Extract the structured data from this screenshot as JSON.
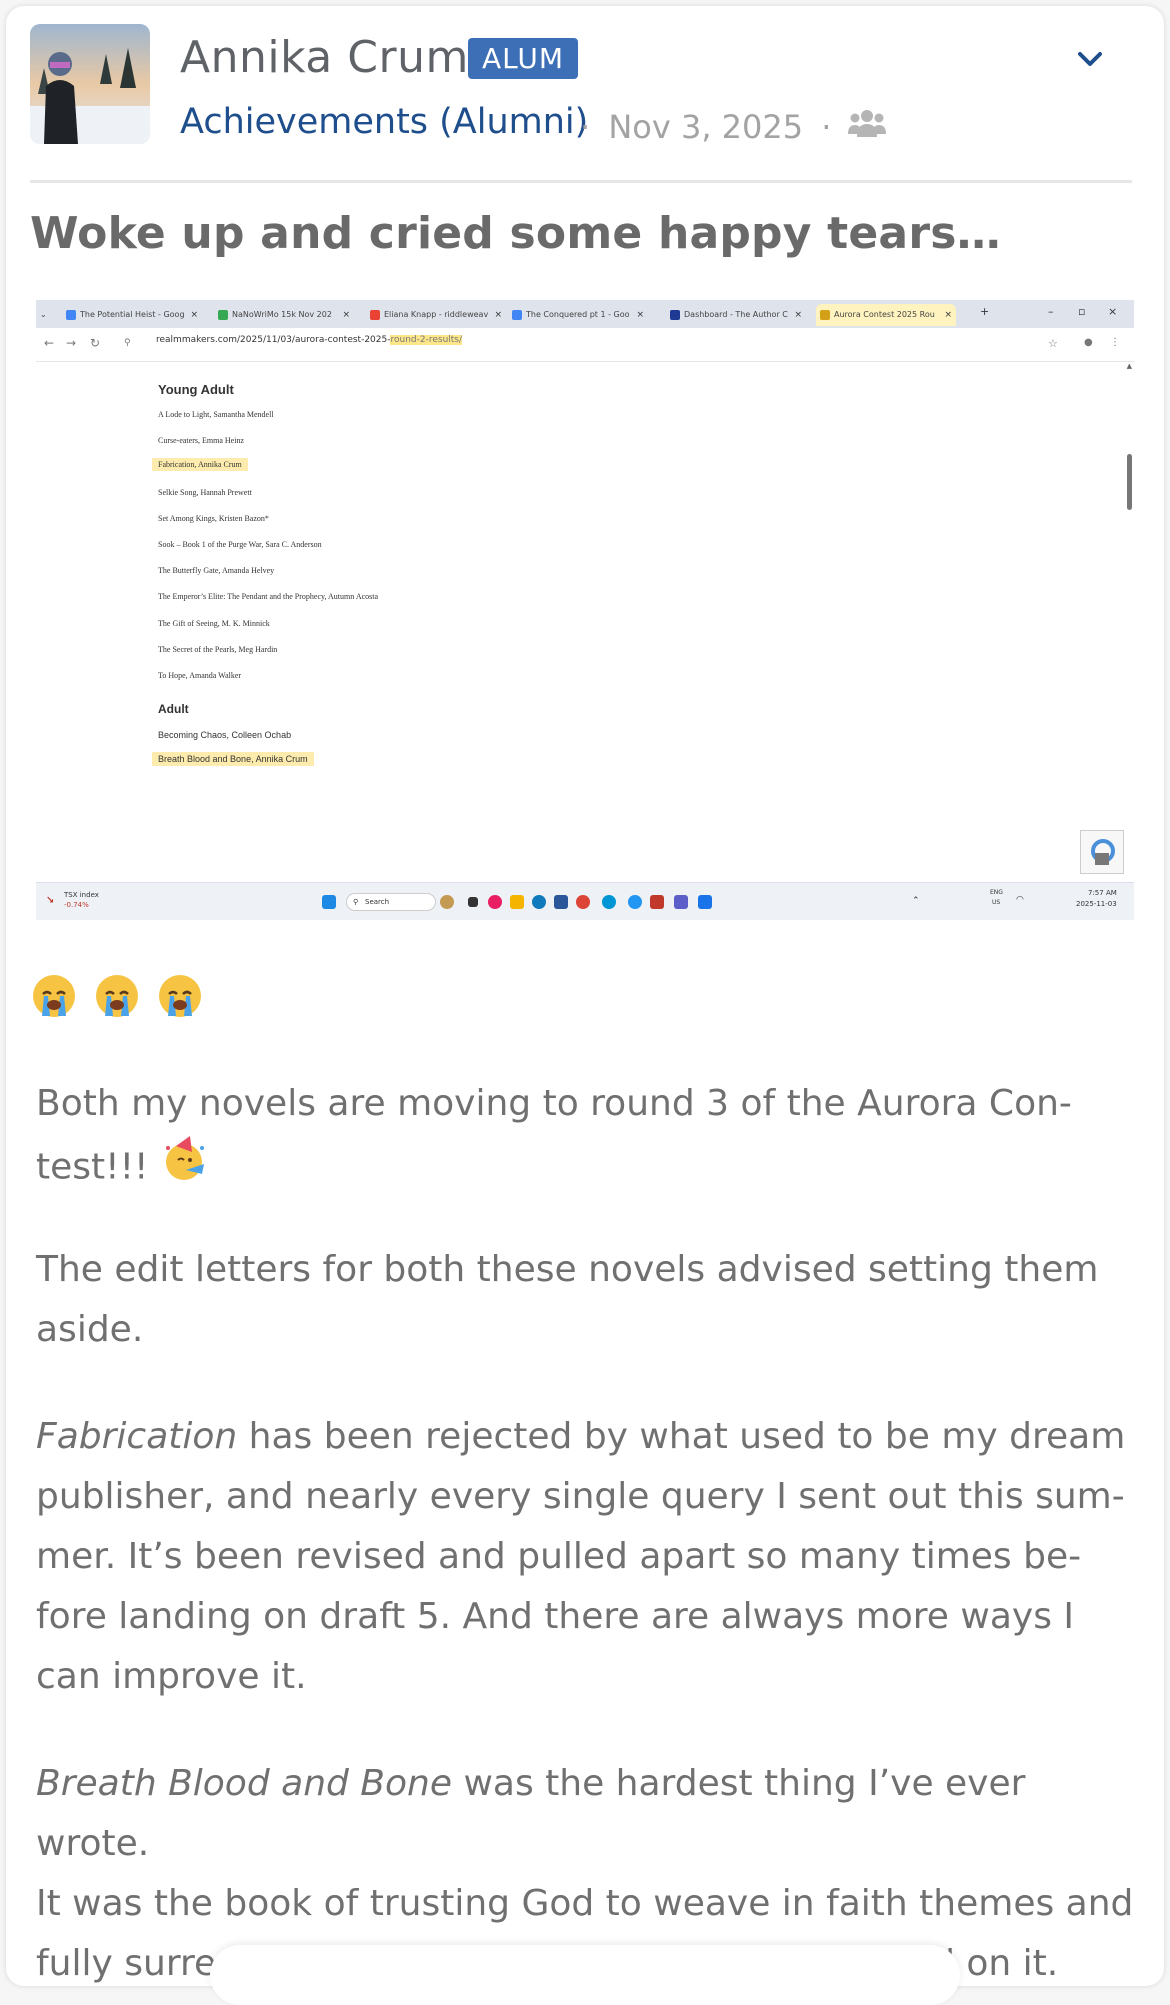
{
  "post": {
    "author": "Annika Crum",
    "badge": "ALUM",
    "group": "Achievements (Alumni)",
    "separator": "·",
    "date": "Nov 3, 2025",
    "privacy_icon": "group-icon",
    "menu_icon": "chevron-down-icon",
    "title": "Woke up and cried some happy tears…"
  },
  "screenshot": {
    "tabs": [
      {
        "label": "The Potential Heist - Goog",
        "color": "#4285f4"
      },
      {
        "label": "NaNoWriMo 15k Nov 202",
        "color": "#34a853"
      },
      {
        "label": "Eliana Knapp - riddleweav",
        "color": "#ea4335"
      },
      {
        "label": "The Conquered pt 1 - Goo",
        "color": "#4285f4"
      },
      {
        "label": "Dashboard - The Author C",
        "color": "#1f3a93"
      },
      {
        "label": "Aurora Contest 2025 Rou",
        "color": "#d4a017"
      }
    ],
    "url_base": "realmmakers.com/2025/11/03/aurora-contest-2025-",
    "url_highlight": "round-2-results/",
    "sections": [
      {
        "heading": "Young Adult",
        "entries": [
          "A Lode to Light, Samantha Mendell",
          "Curse-eaters, Emma Heinz",
          "Fabrication, Annika Crum",
          "Selkie Song, Hannah Prewett",
          "Set Among Kings, Kristen Bazon*",
          "Sook – Book 1 of the Purge War, Sara C. Anderson",
          "The Butterfly Gate, Amanda Helvey",
          "The Emperor’s Elite: The Pendant and the Prophecy, Autumn Acosta",
          "The Gift of Seeing, M. K. Minnick",
          "The Secret of the Pearls, Meg Hardin",
          "To Hope, Amanda Walker"
        ]
      },
      {
        "heading": "Adult",
        "entries": [
          "Becoming Chaos, Colleen Ochab",
          "Breath Blood and Bone, Annika Crum"
        ]
      }
    ],
    "taskbar": {
      "stock_name": "TSX index",
      "stock_change": "-0.74%",
      "search": "Search",
      "lang": "ENG",
      "region": "US",
      "time": "7:57 AM",
      "date": "2025-11-03"
    }
  },
  "body": {
    "emojis": [
      "loudly-crying-face",
      "loudly-crying-face",
      "loudly-crying-face"
    ],
    "p1": "Both my novels are moving to round 3 of the Aurora Con-",
    "p1b": "test!!!",
    "p1_emoji": "partying-face",
    "p2a": "The edit letters for both these novels advised setting them",
    "p2b": "aside.",
    "p3_title": "Fabrication",
    "p3a": " has been rejected by what used to be my dream",
    "p3b": "publisher, and nearly every single query I sent out this sum-",
    "p3c": "mer. It’s been revised and pulled apart so many times be-",
    "p3d": "fore landing on draft 5. And there are always more ways I",
    "p3e": "can improve it.",
    "p4_title": "Breath Blood and Bone",
    "p4a": " was the hardest thing I’ve ever wrote.",
    "p4b": "It was the book of trusting God to weave in faith themes and",
    "p4c": "fully surrender this back to him every day I worked on it."
  }
}
